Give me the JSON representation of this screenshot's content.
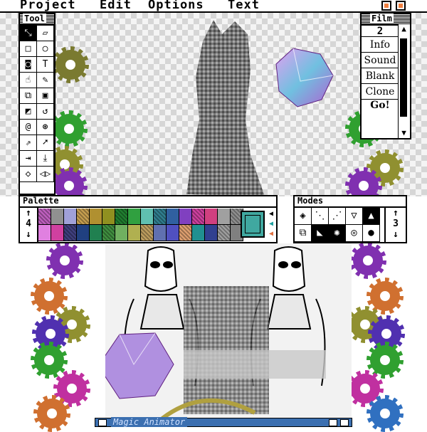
{
  "menubar": {
    "items": [
      "Project",
      "Edit",
      "Options",
      "Text"
    ]
  },
  "tool_window": {
    "title": "Tool",
    "tools": [
      {
        "name": "lasso-icon",
        "glyph": "⤡",
        "selected": true
      },
      {
        "name": "eraser-icon",
        "glyph": "▱",
        "selected": false
      },
      {
        "name": "rectangle-icon",
        "glyph": "□",
        "selected": false
      },
      {
        "name": "oval-icon",
        "glyph": "○",
        "selected": false
      },
      {
        "name": "spray-icon",
        "glyph": "◙",
        "selected": false
      },
      {
        "name": "text-tool-icon",
        "glyph": "T",
        "selected": false
      },
      {
        "name": "hand-icon",
        "glyph": "☝",
        "selected": false
      },
      {
        "name": "pencil-icon",
        "glyph": "✎",
        "selected": false
      },
      {
        "name": "copy-brush-icon",
        "glyph": "⧉",
        "selected": false
      },
      {
        "name": "stamp-icon",
        "glyph": "▣",
        "selected": false
      },
      {
        "name": "bucket-icon",
        "glyph": "◩",
        "selected": false
      },
      {
        "name": "curve-icon",
        "glyph": "↺",
        "selected": false
      },
      {
        "name": "spiral-icon",
        "glyph": "@",
        "selected": false
      },
      {
        "name": "swirl-icon",
        "glyph": "⊛",
        "selected": false
      },
      {
        "name": "paint-icon",
        "glyph": "⇗",
        "selected": false
      },
      {
        "name": "pointer-icon",
        "glyph": "➚",
        "selected": false
      },
      {
        "name": "move-in-icon",
        "glyph": "⇥",
        "selected": false
      },
      {
        "name": "download-icon",
        "glyph": "⤓",
        "selected": false
      },
      {
        "name": "diamond-icon",
        "glyph": "◇",
        "selected": false
      },
      {
        "name": "flip-icon",
        "glyph": "◁▷",
        "selected": false
      }
    ]
  },
  "film_window": {
    "title": "Film",
    "count": "2",
    "buttons": [
      "Info",
      "Sound",
      "Blank",
      "Clone"
    ],
    "go_label": "Go!"
  },
  "palette_window": {
    "title": "Palette",
    "page": "4",
    "arrow_up": "↑",
    "arrow_down": "↓",
    "colors": [
      "#c060c0",
      "#909090",
      "#a0a0d8",
      "#c8a050",
      "#b09030",
      "#909020",
      "#208030",
      "#30a040",
      "#60c0b0",
      "#308090",
      "#3060a0",
      "#8040c0",
      "#d040a0",
      "#d04080",
      "#a0a0a0",
      "#909090",
      "#e080e0",
      "#d040a0",
      "#404080",
      "#204080",
      "#208050",
      "#409040",
      "#70b060",
      "#b0b050",
      "#c0a060",
      "#6070b0",
      "#5050c0",
      "#e0a070",
      "#209090",
      "#304090",
      "#a0a0a0",
      "#808080"
    ],
    "current_color": "#40a8a0"
  },
  "modes_window": {
    "title": "Modes",
    "page": "3",
    "arrow_up": "↑",
    "arrow_down": "↓",
    "modes": [
      {
        "name": "transparent-mode-icon",
        "glyph": "◈",
        "inverted": false
      },
      {
        "name": "dither-mode-icon",
        "glyph": "⋱",
        "inverted": false
      },
      {
        "name": "shade-mode-icon",
        "glyph": "⋰",
        "inverted": false
      },
      {
        "name": "triangle-down-icon",
        "glyph": "▽",
        "inverted": false
      },
      {
        "name": "triangle-up-icon",
        "glyph": "▲",
        "inverted": true
      },
      {
        "name": "copy-mode-icon",
        "glyph": "⧉",
        "inverted": false
      },
      {
        "name": "mountain-mode-icon",
        "glyph": "◣",
        "inverted": true
      },
      {
        "name": "runner-mode-icon",
        "glyph": "✺",
        "inverted": true
      },
      {
        "name": "circle-mode-icon",
        "glyph": "◎",
        "inverted": false
      },
      {
        "name": "filled-circle-icon",
        "glyph": "●",
        "inverted": false
      }
    ]
  },
  "status_bar": {
    "title": "Magic Animator"
  }
}
